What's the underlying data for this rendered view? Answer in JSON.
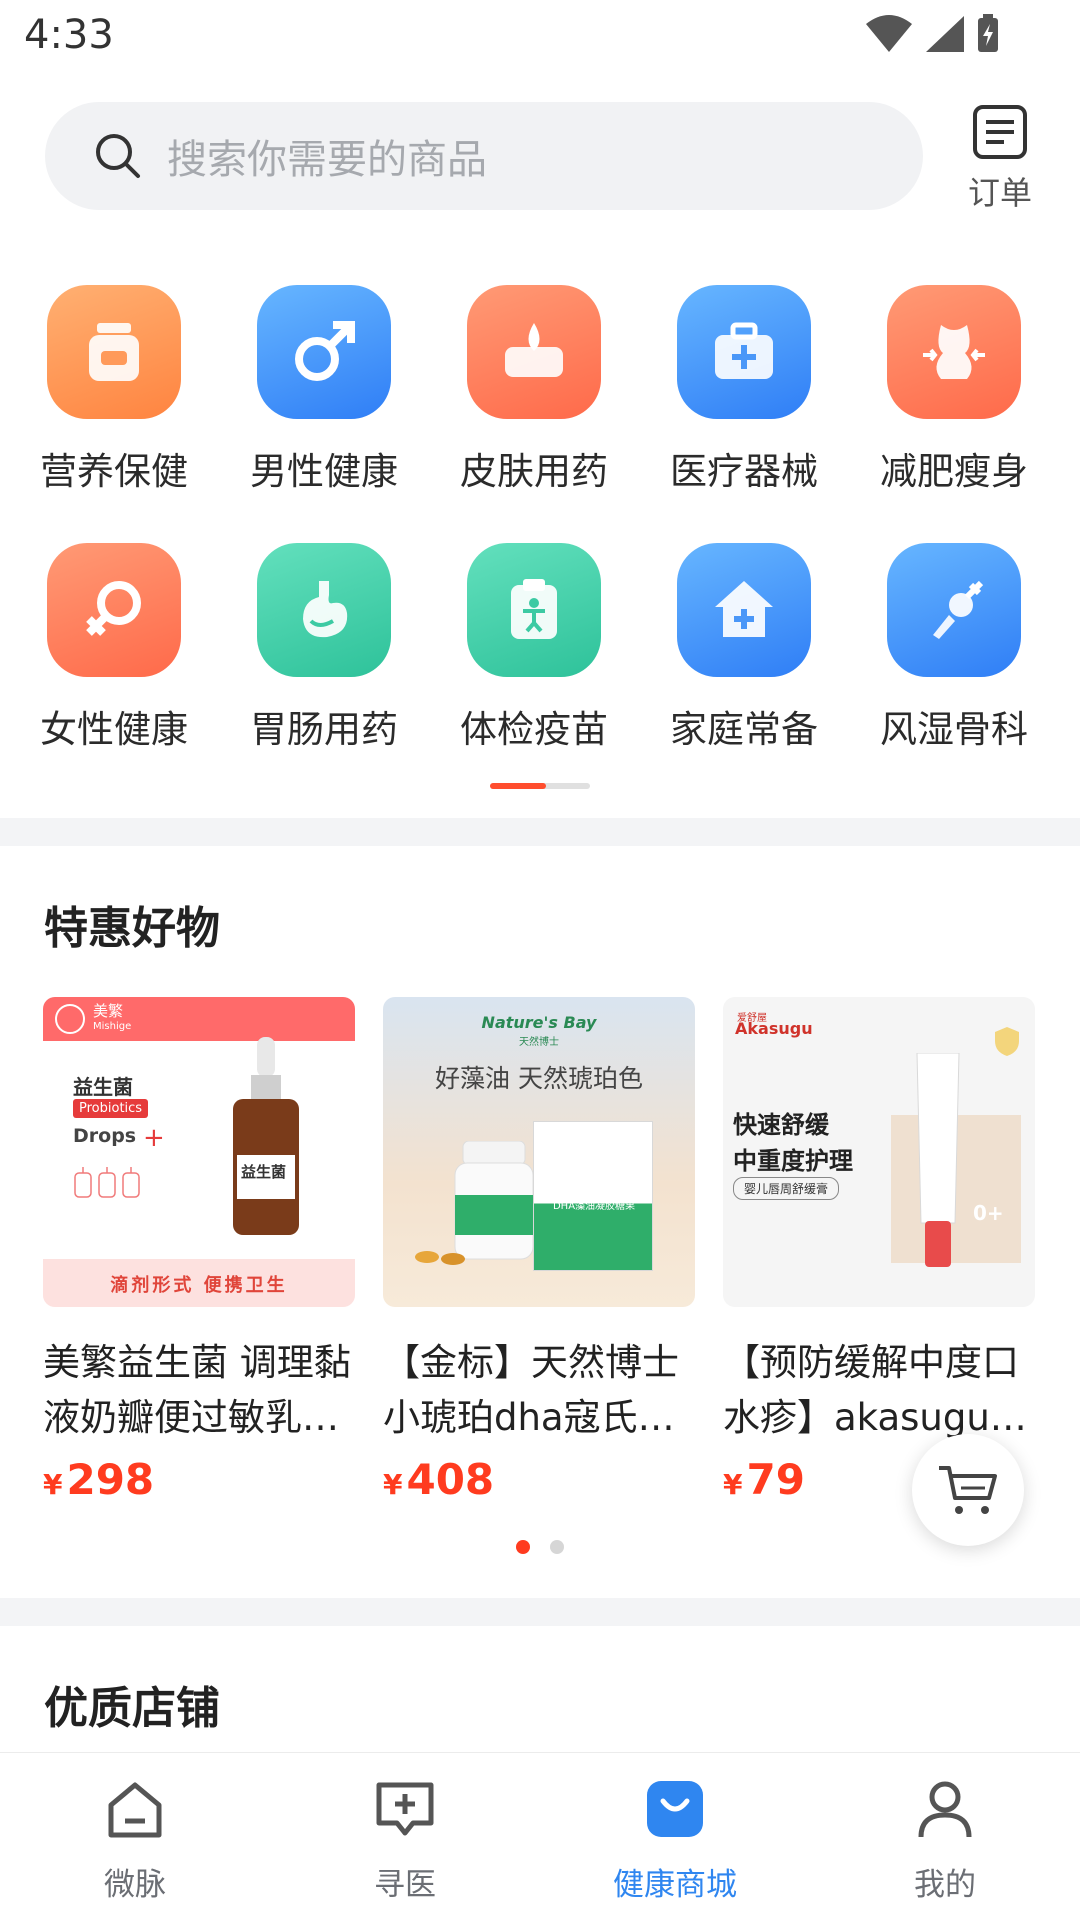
{
  "status": {
    "time": "4:33"
  },
  "search": {
    "placeholder": "搜索你需要的商品"
  },
  "orders": {
    "label": "订单"
  },
  "categories": [
    {
      "label": "营养保健",
      "icon": "nutrition-jar-icon"
    },
    {
      "label": "男性健康",
      "icon": "male-symbol-icon"
    },
    {
      "label": "皮肤用药",
      "icon": "skin-drop-icon"
    },
    {
      "label": "医疗器械",
      "icon": "medical-kit-icon"
    },
    {
      "label": "减肥瘦身",
      "icon": "slim-body-icon"
    },
    {
      "label": "女性健康",
      "icon": "female-symbol-icon"
    },
    {
      "label": "胃肠用药",
      "icon": "stomach-icon"
    },
    {
      "label": "体检疫苗",
      "icon": "checkup-clipboard-icon"
    },
    {
      "label": "家庭常备",
      "icon": "home-medical-icon"
    },
    {
      "label": "风湿骨科",
      "icon": "bone-joint-icon"
    }
  ],
  "deals": {
    "title": "特惠好物",
    "products": [
      {
        "name": "美繁益生菌 调理黏液奶瓣便过敏乳…",
        "currency": "¥",
        "price": "298",
        "image": {
          "brand": "美繁",
          "brand_en": "Mishige",
          "heading": "益生菌",
          "tag": "Probiotics",
          "drops": "Drops",
          "bottle_label": "益生菌",
          "footer": "滴剂形式 便携卫生"
        }
      },
      {
        "name": "【金标】天然博士小琥珀dha寇氏…",
        "currency": "¥",
        "price": "408",
        "image": {
          "brand": "Nature's Bay",
          "brand_cn": "天然博士",
          "headline": "好藻油 天然琥珀色",
          "box_label": "DHA藻油凝胶糖果"
        }
      },
      {
        "name": "【预防缓解中度口水疹】akasugu…",
        "currency": "¥",
        "price": "79",
        "image": {
          "brand": "Akasugu",
          "brand_cn": "爱舒屋",
          "line1": "快速舒缓",
          "line2": "中重度护理",
          "tag": "婴儿唇周舒缓膏",
          "age": "0+"
        }
      }
    ],
    "carousel_pages": 2,
    "carousel_active": 0
  },
  "shops": {
    "title": "优质店铺"
  },
  "bottom_nav": [
    {
      "label": "微脉",
      "icon": "home-icon",
      "active": false
    },
    {
      "label": "寻医",
      "icon": "consult-icon",
      "active": false
    },
    {
      "label": "健康商城",
      "icon": "shopping-bag-icon",
      "active": true
    },
    {
      "label": "我的",
      "icon": "user-icon",
      "active": false
    }
  ],
  "colors": {
    "accent": "#ff3b1f",
    "nav_active": "#2f86f0",
    "indicator": "#ff4d2e"
  }
}
